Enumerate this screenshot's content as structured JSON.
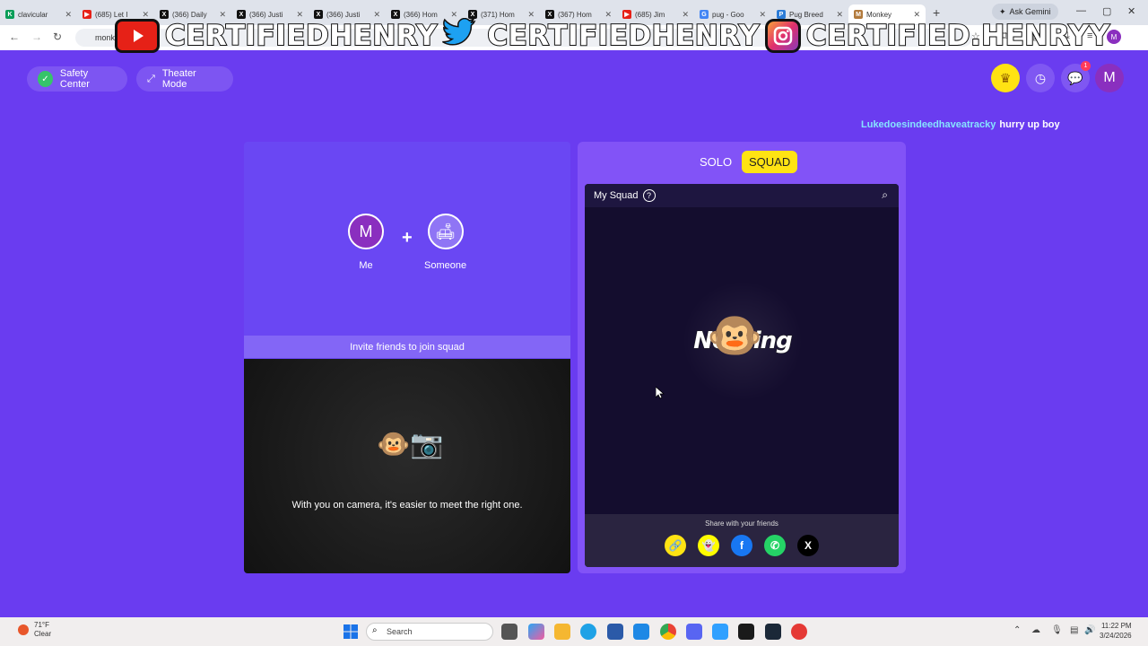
{
  "browser": {
    "tabs": [
      {
        "title": "clavicular",
        "color": "#0a9d58",
        "glyph": "K"
      },
      {
        "title": "(685) Let I",
        "color": "#e62117",
        "glyph": "▶"
      },
      {
        "title": "(366) Daily",
        "color": "#111111",
        "glyph": "X"
      },
      {
        "title": "(366) Justi",
        "color": "#111111",
        "glyph": "X"
      },
      {
        "title": "(366) Justi",
        "color": "#111111",
        "glyph": "X"
      },
      {
        "title": "(366) Hom",
        "color": "#111111",
        "glyph": "X"
      },
      {
        "title": "(371) Hom",
        "color": "#111111",
        "glyph": "X"
      },
      {
        "title": "(367) Hom",
        "color": "#111111",
        "glyph": "X"
      },
      {
        "title": "(685) Jim",
        "color": "#e62117",
        "glyph": "▶"
      },
      {
        "title": "pug - Goo",
        "color": "#4285f4",
        "glyph": "G"
      },
      {
        "title": "Pug Breed",
        "color": "#2b7bd6",
        "glyph": "P"
      },
      {
        "title": "Monkey",
        "color": "#b27a3c",
        "glyph": "M"
      }
    ],
    "new_tab": "+",
    "gemini_label": "Ask Gemini",
    "url_text": "monk",
    "profile_initial": "M"
  },
  "banner": {
    "youtube": "CERTIFIEDHENRY",
    "twitter": "CERTIFIEDHENRY",
    "instagram": "CERTIFIED.HENRYY"
  },
  "header": {
    "safety_center": "Safety Center",
    "theater_mode": "Theater Mode",
    "notification_count": "1",
    "me_initial": "M"
  },
  "chat": {
    "user": "Lukedoesindeedhaveatracky",
    "message": "hurry up boy"
  },
  "left_panel": {
    "me_initial": "M",
    "me_label": "Me",
    "plus": "+",
    "someone_label": "Someone",
    "invite_text": "Invite friends to join squad",
    "camera_caption": "With you on camera, it's easier to meet the right one."
  },
  "right_panel": {
    "solo_label": "SOLO",
    "squad_label": "SQUAD",
    "my_squad_label": "My Squad",
    "help_glyph": "?",
    "empty_word": "Nothing",
    "share_label": "Share with your friends"
  },
  "taskbar": {
    "temp": "71°F",
    "condition": "Clear",
    "search_placeholder": "Search",
    "time": "11:22 PM",
    "date": "3/24/2026"
  },
  "colors": {
    "background": "#6a3cf0",
    "accent_yellow": "#ffe313",
    "squad_bg": "#140d2e"
  }
}
